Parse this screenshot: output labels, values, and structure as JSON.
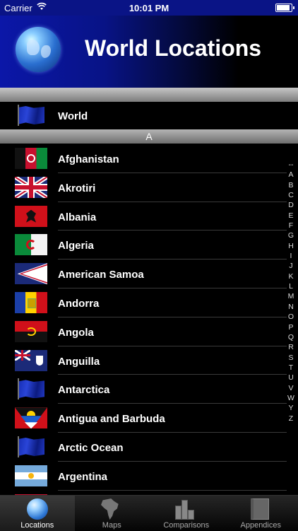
{
  "status_bar": {
    "carrier": "Carrier",
    "time": "10:01 PM",
    "battery_level": 1.0
  },
  "header": {
    "title": "World Locations",
    "logo_icon": "globe-icon"
  },
  "world_row": {
    "label": "World",
    "flag": "blue-flag"
  },
  "section": {
    "letter": "A"
  },
  "countries": [
    {
      "name": "Afghanistan",
      "flag": "af"
    },
    {
      "name": "Akrotiri",
      "flag": "uk"
    },
    {
      "name": "Albania",
      "flag": "al"
    },
    {
      "name": "Algeria",
      "flag": "dz"
    },
    {
      "name": "American Samoa",
      "flag": "as"
    },
    {
      "name": "Andorra",
      "flag": "ad"
    },
    {
      "name": "Angola",
      "flag": "ao"
    },
    {
      "name": "Anguilla",
      "flag": "ai"
    },
    {
      "name": "Antarctica",
      "flag": "blue"
    },
    {
      "name": "Antigua and Barbuda",
      "flag": "ag"
    },
    {
      "name": "Arctic Ocean",
      "flag": "blue"
    },
    {
      "name": "Argentina",
      "flag": "ar"
    }
  ],
  "index_letters": [
    "--",
    "A",
    "B",
    "C",
    "D",
    "E",
    "F",
    "G",
    "H",
    "I",
    "J",
    "K",
    "L",
    "M",
    "N",
    "O",
    "P",
    "Q",
    "R",
    "S",
    "T",
    "U",
    "V",
    "W",
    "Y",
    "Z"
  ],
  "tabs": [
    {
      "label": "Locations",
      "icon": "globe-icon",
      "active": true
    },
    {
      "label": "Maps",
      "icon": "africa-map-icon",
      "active": false
    },
    {
      "label": "Comparisons",
      "icon": "bar-chart-icon",
      "active": false
    },
    {
      "label": "Appendices",
      "icon": "book-icon",
      "active": false
    }
  ],
  "colors": {
    "header_blue": "#0b17a8",
    "background": "#000000",
    "separator": "#3a3a3a"
  }
}
